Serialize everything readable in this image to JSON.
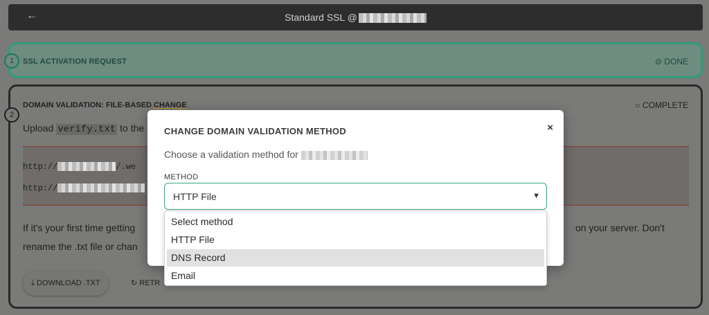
{
  "topbar": {
    "back_icon": "←",
    "title": "Standard SSL @"
  },
  "step1": {
    "number": "1",
    "label": "SSL ACTIVATION REQUEST",
    "status_icon": "⊘",
    "status": "DONE"
  },
  "step2": {
    "number": "2",
    "label_prefix": "DOMAIN VALIDATION: FILE-BASED ",
    "label_link": "CHANGE",
    "status_icon": "○",
    "status": "COMPLETE",
    "upload_prefix": "Upload ",
    "upload_file": "verify.txt",
    "upload_suffix": " to the",
    "urls": [
      "http://",
      "http://"
    ],
    "url1_suffix": "/.we",
    "desc_line1_left": "If it's your first time getting",
    "desc_line1_right": "on your server. Don't",
    "desc_line2_left": "rename the .txt file or chan",
    "download_icon": "⤓",
    "download_label": "DOWNLOAD .TXT",
    "retry_icon": "↻",
    "retry_label": "RETR"
  },
  "modal": {
    "title": "CHANGE DOMAIN VALIDATION METHOD",
    "close_icon": "×",
    "subtitle": "Choose a validation method for",
    "method_label": "METHOD",
    "selected": "HTTP File",
    "caret": "▼",
    "options": [
      "Select method",
      "HTTP File",
      "DNS Record",
      "Email"
    ],
    "highlighted_option": "DNS Record"
  },
  "colors": {
    "accent": "#3aa47e",
    "done_green": "#2f9d79",
    "backdrop": "#7a7a78"
  }
}
